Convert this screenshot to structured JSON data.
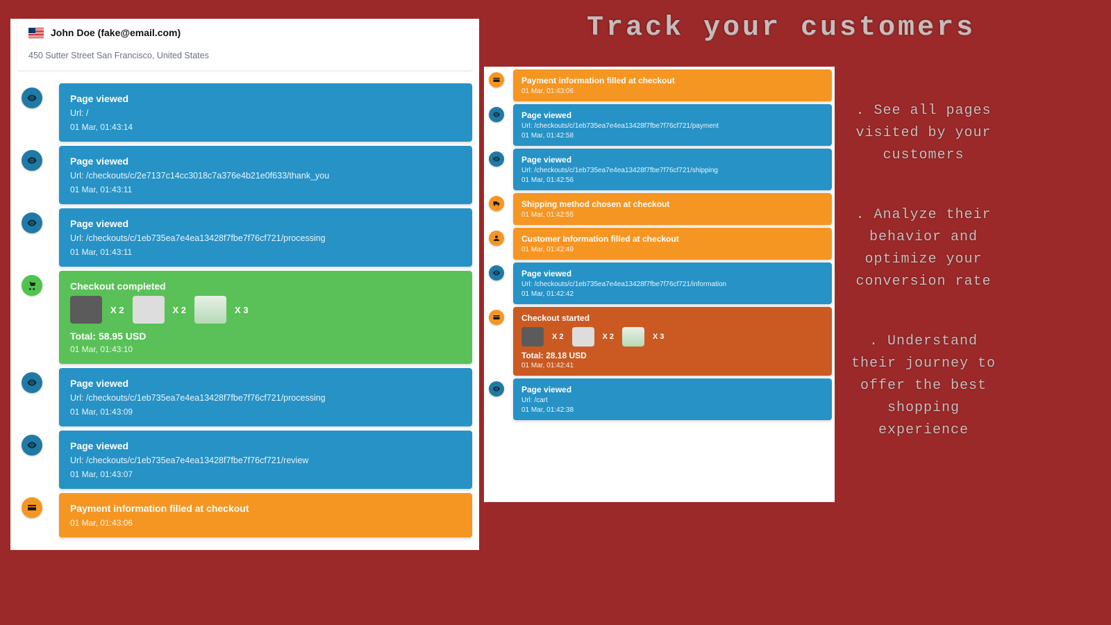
{
  "customer": {
    "name": "John Doe (fake@email.com)",
    "address": "450 Sutter Street San Francisco, United States"
  },
  "left_events": [
    {
      "kind": "blue",
      "icon": "eye",
      "title": "Page viewed",
      "url": "Url: /",
      "ts": "01 Mar, 01:43:14"
    },
    {
      "kind": "blue",
      "icon": "eye",
      "title": "Page viewed",
      "url": "Url: /checkouts/c/2e7137c14cc3018c7a376e4b21e0f633/thank_you",
      "ts": "01 Mar, 01:43:11"
    },
    {
      "kind": "blue",
      "icon": "eye",
      "title": "Page viewed",
      "url": "Url: /checkouts/c/1eb735ea7e4ea13428f7fbe7f76cf721/processing",
      "ts": "01 Mar, 01:43:11"
    },
    {
      "kind": "green",
      "icon": "cart",
      "title": "Checkout completed",
      "items": [
        {
          "c": "dark",
          "q": "X 2"
        },
        {
          "c": "",
          "q": "X 2"
        },
        {
          "c": "green",
          "q": "X 3"
        }
      ],
      "total": "Total: 58.95 USD",
      "ts": "01 Mar, 01:43:10"
    },
    {
      "kind": "blue",
      "icon": "eye",
      "title": "Page viewed",
      "url": "Url: /checkouts/c/1eb735ea7e4ea13428f7fbe7f76cf721/processing",
      "ts": "01 Mar, 01:43:09"
    },
    {
      "kind": "blue",
      "icon": "eye",
      "title": "Page viewed",
      "url": "Url: /checkouts/c/1eb735ea7e4ea13428f7fbe7f76cf721/review",
      "ts": "01 Mar, 01:43:07"
    },
    {
      "kind": "orange",
      "icon": "card",
      "title": "Payment information filled at checkout",
      "ts": "01 Mar, 01:43:06"
    }
  ],
  "right_events": [
    {
      "kind": "orange",
      "icon": "card",
      "title": "Payment information filled at checkout",
      "ts": "01 Mar, 01:43:06"
    },
    {
      "kind": "blue",
      "icon": "eye",
      "title": "Page viewed",
      "url": "Url: /checkouts/c/1eb735ea7e4ea13428f7fbe7f76cf721/payment",
      "ts": "01 Mar, 01:42:58"
    },
    {
      "kind": "blue",
      "icon": "eye",
      "title": "Page viewed",
      "url": "Url: /checkouts/c/1eb735ea7e4ea13428f7fbe7f76cf721/shipping",
      "ts": "01 Mar, 01:42:56"
    },
    {
      "kind": "orange",
      "icon": "truck",
      "title": "Shipping method chosen at checkout",
      "ts": "01 Mar, 01:42:55"
    },
    {
      "kind": "orange",
      "icon": "user",
      "title": "Customer Information filled at checkout",
      "ts": "01 Mar, 01:42:49"
    },
    {
      "kind": "blue",
      "icon": "eye",
      "title": "Page viewed",
      "url": "Url: /checkouts/c/1eb735ea7e4ea13428f7fbe7f76cf721/information",
      "ts": "01 Mar, 01:42:42"
    },
    {
      "kind": "dkorange",
      "icon": "card",
      "title": "Checkout started",
      "items": [
        {
          "c": "dark",
          "q": "X 2"
        },
        {
          "c": "",
          "q": "X 2"
        },
        {
          "c": "green",
          "q": "X 3"
        }
      ],
      "total": "Total: 28.18 USD",
      "ts": "01 Mar, 01:42:41"
    },
    {
      "kind": "blue",
      "icon": "eye",
      "title": "Page viewed",
      "url": "Url: /cart",
      "ts": "01 Mar, 01:42:38"
    }
  ],
  "headline": "Track your customers",
  "bullets": {
    "b1": ". See all pages visited by your customers",
    "b2": ". Analyze their behavior and optimize your conversion rate",
    "b3": ". Understand their journey to offer the best shopping experience"
  }
}
